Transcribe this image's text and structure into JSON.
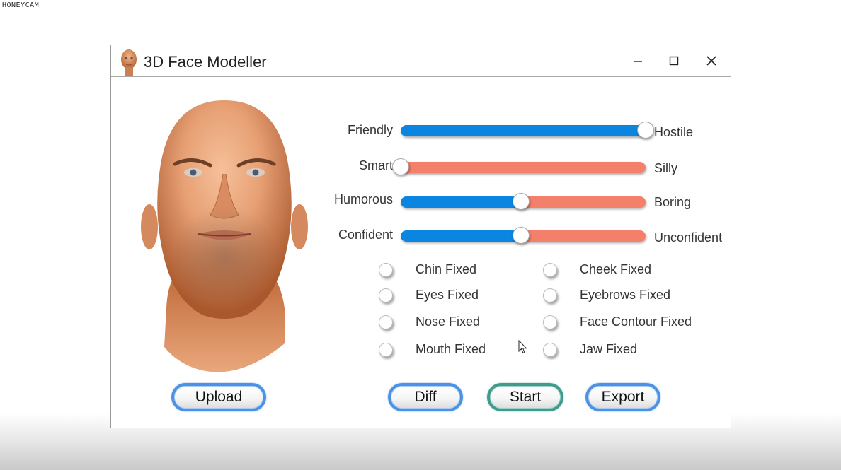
{
  "watermark": "HONEYCAM",
  "window": {
    "title": "3D Face Modeller"
  },
  "sliders": [
    {
      "left_label": "Friendly",
      "right_label": "Hostile",
      "value": 1.0,
      "style": "blue"
    },
    {
      "left_label": "Smart",
      "right_label": "Silly",
      "value": 0.0,
      "style": "red"
    },
    {
      "left_label": "Humorous",
      "right_label": "Boring",
      "value": 0.49,
      "style": "split"
    },
    {
      "left_label": "Confident",
      "right_label": "Unconfident",
      "value": 0.49,
      "style": "split"
    }
  ],
  "checkboxes": {
    "left": [
      {
        "label": "Chin Fixed",
        "checked": false
      },
      {
        "label": "Eyes Fixed",
        "checked": false
      },
      {
        "label": "Nose Fixed",
        "checked": false
      },
      {
        "label": "Mouth Fixed",
        "checked": false
      }
    ],
    "right": [
      {
        "label": "Cheek Fixed",
        "checked": false
      },
      {
        "label": "Eyebrows Fixed",
        "checked": false
      },
      {
        "label": "Face Contour Fixed",
        "checked": false
      },
      {
        "label": "Jaw Fixed",
        "checked": false
      }
    ]
  },
  "buttons": {
    "upload": "Upload",
    "diff": "Diff",
    "start": "Start",
    "export": "Export"
  },
  "colors": {
    "slider_blue": "#0a86e0",
    "slider_red": "#f4806b",
    "button_border_blue": "#4c92e4",
    "button_border_teal": "#3f9b8e"
  },
  "icons": {
    "app": "face-avatar-icon",
    "minimize": "minimize-icon",
    "maximize": "maximize-icon",
    "close": "close-icon"
  }
}
